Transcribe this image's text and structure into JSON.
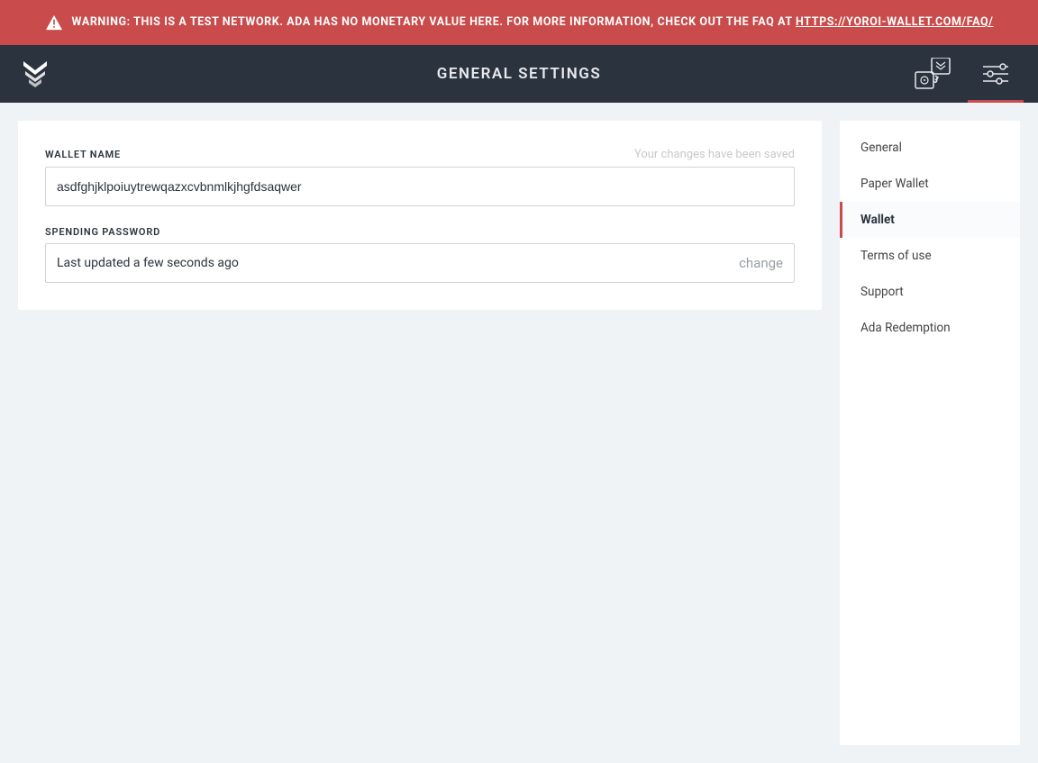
{
  "colors": {
    "accent_red": "#c94b4b",
    "nav_bg": "#2b333f",
    "page_bg": "#f0f3f5"
  },
  "warning": {
    "text_prefix": "WARNING: THIS IS A TEST NETWORK. ADA HAS NO MONETARY VALUE HERE. FOR MORE INFORMATION, CHECK OUT THE FAQ AT ",
    "link_text": "HTTPS://YOROI-WALLET.COM/FAQ/"
  },
  "header": {
    "title": "GENERAL SETTINGS"
  },
  "main": {
    "wallet_name": {
      "label": "WALLET NAME",
      "value": "asdfghjklpoiuytrewqazxcvbnmlkjhgfdsaqwer",
      "saved_message": "Your changes have been saved"
    },
    "spending_password": {
      "label": "SPENDING PASSWORD",
      "status": "Last updated a few seconds ago",
      "action": "change"
    }
  },
  "sidebar": {
    "items": [
      {
        "label": "General",
        "active": false
      },
      {
        "label": "Paper Wallet",
        "active": false
      },
      {
        "label": "Wallet",
        "active": true
      },
      {
        "label": "Terms of use",
        "active": false
      },
      {
        "label": "Support",
        "active": false
      },
      {
        "label": "Ada Redemption",
        "active": false
      }
    ]
  }
}
